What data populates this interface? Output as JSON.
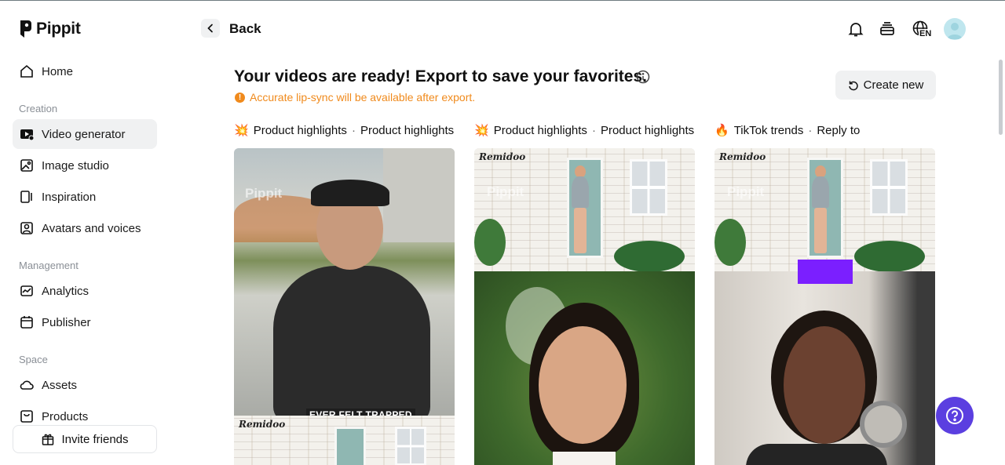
{
  "brand": {
    "name": "Pippit"
  },
  "header": {
    "back_label": "Back",
    "language_badge": "EN"
  },
  "sidebar": {
    "home": "Home",
    "sections": [
      {
        "label": "Creation",
        "items": [
          "Video generator",
          "Image studio",
          "Inspiration",
          "Avatars and voices"
        ]
      },
      {
        "label": "Management",
        "items": [
          "Analytics",
          "Publisher"
        ]
      },
      {
        "label": "Space",
        "items": [
          "Assets",
          "Products"
        ]
      }
    ],
    "active_item": "Video generator",
    "invite_label": "Invite friends"
  },
  "main": {
    "title": "Your videos are ready! Export to save your favorites.",
    "notice": "Accurate lip-sync will be available after export.",
    "create_new_label": "Create new",
    "columns": [
      {
        "emoji": "💥",
        "category": "Product highlights",
        "subtitle": "Product highlights"
      },
      {
        "emoji": "💥",
        "category": "Product highlights",
        "subtitle": "Product highlights"
      },
      {
        "emoji": "🔥",
        "category": "TikTok trends",
        "subtitle": "Reply to"
      }
    ],
    "card_texts": {
      "brand_tag": "Remidoo",
      "watermark": "Pippit",
      "caption": "EVER FELT TRAPPED"
    }
  },
  "colors": {
    "accent": "#5b3fe0",
    "warning": "#f08a1c",
    "active_bg": "#f0f1f2",
    "highlight_block": "#7b1fff"
  },
  "help": {
    "icon": "question-icon"
  }
}
